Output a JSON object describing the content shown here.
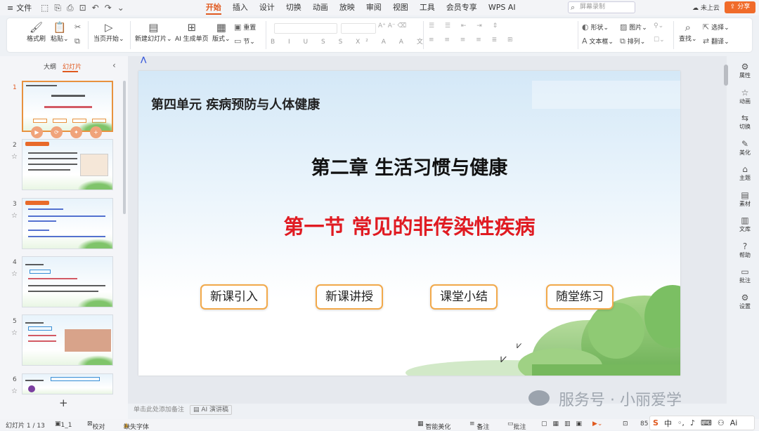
{
  "title_bar": {
    "file_label": "文件",
    "tabs": [
      "开始",
      "插入",
      "设计",
      "切换",
      "动画",
      "放映",
      "审阅",
      "视图",
      "工具",
      "会员专享",
      "WPS AI"
    ],
    "active_tab": "开始",
    "search_placeholder": "屏幕录制",
    "cloud_label": "未上云",
    "share_label": "分享"
  },
  "ribbon": {
    "format_painter": "格式刷",
    "paste": "粘贴",
    "start_from_current": "当页开始",
    "new_slide": "新建幻灯片",
    "ai_generate": "AI 生成单页",
    "layout": "版式",
    "reset": "重置",
    "section": "节",
    "shape": "形状",
    "picture": "图片",
    "textbox": "文本框",
    "arrange": "排列",
    "find": "查找",
    "select": "选择",
    "translate": "翻译"
  },
  "left_panel": {
    "tab_outline": "大纲",
    "tab_slides": "幻灯片",
    "slide_numbers": [
      "1",
      "2",
      "3",
      "4",
      "5",
      "6"
    ]
  },
  "slide": {
    "unit": "第四单元  疾病预防与人体健康",
    "chapter": "第二章  生活习惯与健康",
    "section": "第一节  常见的非传染性疾病",
    "buttons": [
      "新课引入",
      "新课讲授",
      "课堂小结",
      "随堂练习"
    ]
  },
  "notes": {
    "placeholder": "单击此处添加备注",
    "ai_label": "AI 演讲稿"
  },
  "right_bar": [
    "属性",
    "动画",
    "切换",
    "美化",
    "主题",
    "素材",
    "文库",
    "帮助",
    "批注",
    "设置"
  ],
  "status_bar": {
    "slide_count": "幻灯片 1 / 13",
    "theme": "1_1",
    "proofread": "校对",
    "missing_font": "缺失字体",
    "smart_beautify": "智能美化",
    "notes": "备注",
    "comments": "批注",
    "zoom": "85"
  },
  "watermark": "服务号 · 小丽爱学",
  "colors": {
    "accent": "#e0591f",
    "section_red": "#e01b22",
    "pill_border": "#f2a94a"
  }
}
